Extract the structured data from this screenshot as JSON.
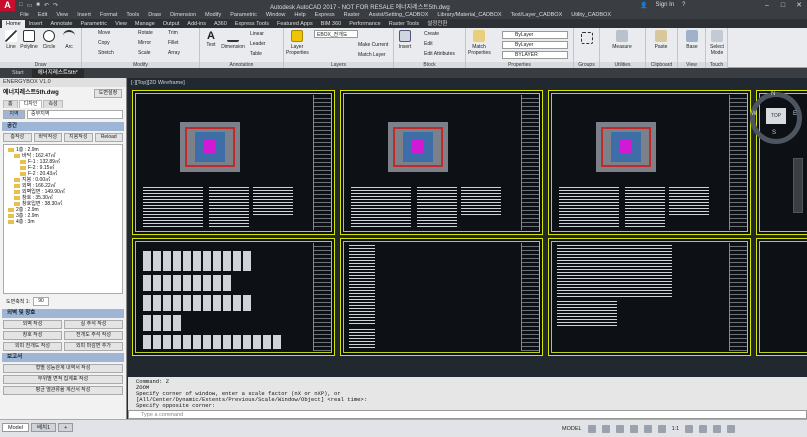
{
  "titlebar": {
    "logo": "A",
    "title": "Autodesk AutoCAD 2017 - NOT FOR RESALE    에너지레스트5th.dwg",
    "signin": "Sign In",
    "help": "?"
  },
  "menubar": [
    "File",
    "Edit",
    "View",
    "Insert",
    "Format",
    "Tools",
    "Draw",
    "Dimension",
    "Modify",
    "Parametric",
    "Window",
    "Help",
    "Express",
    "Raster",
    "Assist/Setting_CADBOX",
    "Library/Material_CADBOX",
    "Text/Layer_CADBOX",
    "Utility_CADBOX"
  ],
  "ribbon_tabs": [
    "Home",
    "Insert",
    "Annotate",
    "Parametric",
    "View",
    "Manage",
    "Output",
    "Add-ins",
    "A360",
    "Express Tools",
    "Featured Apps",
    "BIM 360",
    "Performance",
    "Raster Tools",
    "설정전환"
  ],
  "ribbon": {
    "draw": {
      "label": "Draw",
      "tools": [
        "Line",
        "Polyline",
        "Circle",
        "Arc"
      ]
    },
    "modify": {
      "label": "Modify",
      "tools": [
        "Move",
        "Rotate",
        "Trim",
        "Copy",
        "Mirror",
        "Fillet",
        "Stretch",
        "Scale",
        "Array"
      ]
    },
    "annotation": {
      "label": "Annotation",
      "tools": [
        "Text",
        "Dimension",
        "Linear",
        "Leader",
        "Table"
      ]
    },
    "layers": {
      "label": "Layers",
      "tools": [
        "Layer Properties",
        "Make Current",
        "Match Layer"
      ],
      "current": "EBOX_전개도"
    },
    "block": {
      "label": "Block",
      "tools": [
        "Insert",
        "Create",
        "Edit",
        "Edit Attributes"
      ]
    },
    "properties": {
      "label": "Properties",
      "tools": [
        "Match Properties"
      ],
      "values": [
        "ByLayer",
        "ByLayer",
        "BYLAYER"
      ]
    },
    "groups": {
      "label": "Groups",
      "tools": [
        "Group"
      ]
    },
    "utilities": {
      "label": "Utilities",
      "tools": [
        "Measure"
      ]
    },
    "clipboard": {
      "label": "Clipboard",
      "tools": [
        "Paste"
      ]
    },
    "view": {
      "label": "View",
      "tools": [
        "Base"
      ]
    },
    "touch": {
      "label": "Touch",
      "tools": [
        "Select Mode"
      ]
    }
  },
  "doc_tabs": [
    "Start",
    "에너지레스트5th*"
  ],
  "palette": {
    "header": "ENERGYBOX V1.0",
    "file": "에너지레스트5th.dwg",
    "settings_btn": "도면설정",
    "tabs": [
      "홈",
      "디자인",
      "속성"
    ],
    "region_label": "지역",
    "region_value": "중부지역",
    "space_section": "공간",
    "space_buttons": [
      "층작성",
      "바닥작성",
      "지붕작성",
      "Reload"
    ],
    "tree": [
      "1층 : 2.9m",
      "바닥 : 162.47㎡",
      "F-1 : 132.89㎡",
      "F-2 : 9.15㎡",
      "F-2 : 20.43㎡",
      "지붕 : 0.00㎡",
      "외벽 : 166.22㎡",
      "외벽입면 : 149.90㎡",
      "창호 : 35.30㎡",
      "창호입면 : 38.30㎡",
      "2층 : 2.9m",
      "3층 : 2.9m",
      "4층 : 3m"
    ],
    "scale_label": "도면축척 1:",
    "scale_value": "90",
    "wall_section": "외벽 및 창호",
    "wall_buttons": [
      "외벽 작성",
      "실 주석 작성",
      "창호 작성",
      "전개도 주석 작성",
      "외피 전개도 작성",
      "외피 마감면 추가"
    ],
    "report_section": "보고서",
    "report_buttons": [
      "형별 성능관계 내역서 작성",
      "부위별 면적 집계표 작성",
      "평균 열관류율 계산서 작성"
    ]
  },
  "canvas": {
    "viewport_label": "[-][Top][2D Wireframe]",
    "viewcube": {
      "top": "TOP",
      "n": "N",
      "s": "S",
      "e": "E",
      "w": "W"
    }
  },
  "command": {
    "history": [
      "Command: Z",
      "ZOOM",
      "Specify corner of window, enter a scale factor (nX or nXP), or",
      "[All/Center/Dynamic/Extents/Previous/Scale/Window/Object] <real time>:",
      "Specify opposite corner:"
    ],
    "placeholder": "Type a command"
  },
  "status": {
    "tabs": [
      "Model",
      "배치1",
      "+"
    ],
    "model": "MODEL",
    "scale": "1:1"
  }
}
